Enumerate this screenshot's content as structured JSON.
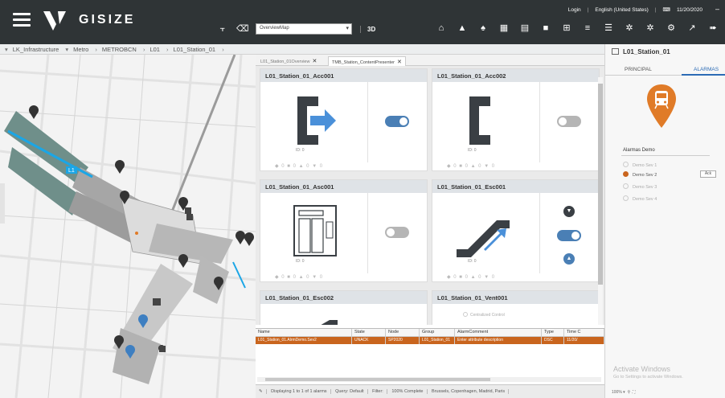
{
  "header": {
    "logo_text": "GISIZE",
    "user": "Login",
    "language": "English (United States)",
    "date": "11/20/2020",
    "map_dropdown_value": "OverviewMap",
    "btn_3d": "3D"
  },
  "breadcrumb": [
    "LK_Infrastructure",
    "Metro",
    "METROBCN",
    "L01",
    "L01_Station_01"
  ],
  "tabs": [
    "L01_Station_01Overview",
    "TMB_Station_ContentPresenter"
  ],
  "cards": [
    {
      "title": "L01_Station_01_Acc001",
      "id_label": "ID: 0",
      "toggle": "on"
    },
    {
      "title": "L01_Station_01_Acc002",
      "id_label": "ID: 0",
      "toggle": "off"
    },
    {
      "title": "L01_Station_01_Asc001",
      "id_label": "ID: 0",
      "toggle": "off"
    },
    {
      "title": "L01_Station_01_Esc001",
      "id_label": "ID: 0",
      "toggle": "on"
    },
    {
      "title": "L01_Station_01_Esc002"
    },
    {
      "title": "L01_Station_01_Vent001",
      "note": "Centralized Control"
    }
  ],
  "status_indicators": "◆ 0  ■ 0  ▲ 0  ▼ 0",
  "alarm_grid": {
    "columns": [
      "Name",
      "State",
      "Node",
      "Group",
      "AlarmComment",
      "Type",
      "Time C"
    ],
    "rows": [
      [
        "L01_Station_01.AlrmDemo.Sev2",
        "UNACK",
        "SP2020",
        "L01_Station_01",
        "Enter attribute description",
        "DSC",
        "11/20/"
      ]
    ]
  },
  "status_bar": {
    "displaying": "Displaying 1 to 1 of 1 alarms",
    "query": "Query: Default",
    "filter": "Filter:",
    "complete": "100% Complete",
    "location": "Brussels, Copenhagen, Madrid, Paris"
  },
  "map": {
    "line_label": "L1"
  },
  "right_panel": {
    "title": "L01_Station_01",
    "tab_principal": "PRINCIPAL",
    "tab_alarms": "ALARMAS",
    "section_title": "Alarmas Demo",
    "alarms": [
      "Demo Sev 1",
      "Demo Sev 2",
      "Demo Sev 3",
      "Demo Sev 4"
    ],
    "active_alarm_index": 1,
    "ack_label": "Ack",
    "watermark_title": "Activate Windows",
    "watermark_sub": "Go to Settings to activate Windows."
  },
  "zoom": "100%",
  "colors": {
    "header_bg": "#2f3436",
    "accent_orange": "#e07b28",
    "toggle_on": "#4a7fb5",
    "alarm_row": "#c9651e",
    "active_tab": "#2c6bb5"
  }
}
